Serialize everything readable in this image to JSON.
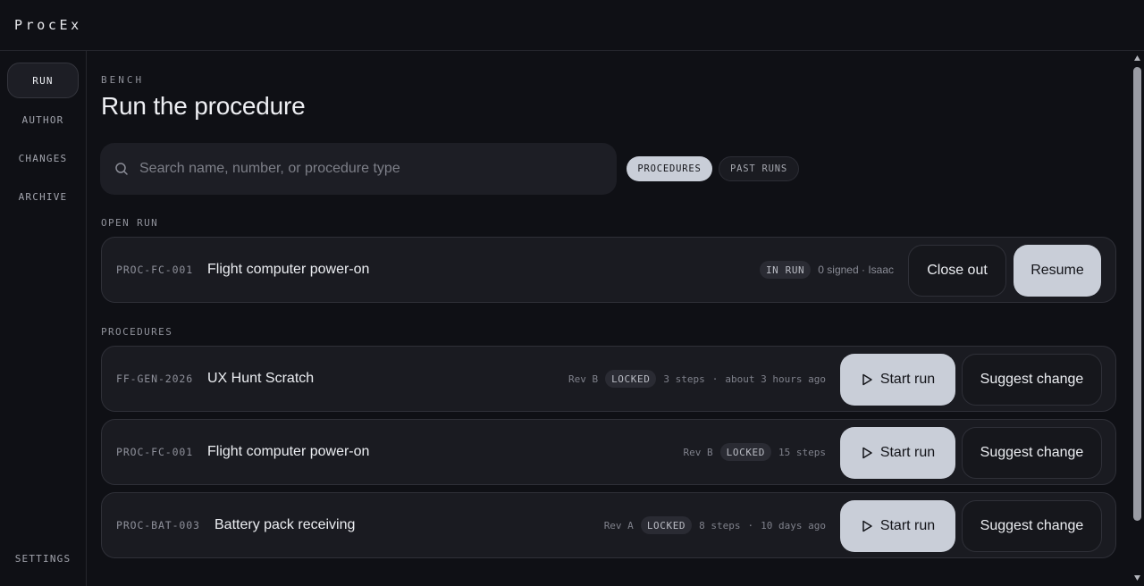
{
  "app": {
    "brand": "ProcEx"
  },
  "nav": {
    "items": [
      {
        "label": "RUN",
        "active": true
      },
      {
        "label": "AUTHOR",
        "active": false
      },
      {
        "label": "CHANGES",
        "active": false
      },
      {
        "label": "ARCHIVE",
        "active": false
      }
    ],
    "settings": "SETTINGS"
  },
  "header": {
    "eyebrow": "BENCH",
    "title": "Run the procedure"
  },
  "search": {
    "placeholder": "Search name, number, or procedure type",
    "value": ""
  },
  "filters": [
    {
      "label": "PROCEDURES",
      "active": true
    },
    {
      "label": "PAST RUNS",
      "active": false
    }
  ],
  "open_run": {
    "section_label": "OPEN RUN",
    "code": "PROC-FC-001",
    "name": "Flight computer power-on",
    "status": "IN RUN",
    "signed": "0 signed · Isaac",
    "close_label": "Close out",
    "resume_label": "Resume"
  },
  "procedures": {
    "section_label": "PROCEDURES",
    "start_label": "Start run",
    "suggest_label": "Suggest change",
    "items": [
      {
        "code": "FF-GEN-2026",
        "name": "UX Hunt Scratch",
        "rev": "Rev B",
        "lock": "LOCKED",
        "steps": "3 steps",
        "sep": "·",
        "age": "about 3 hours ago"
      },
      {
        "code": "PROC-FC-001",
        "name": "Flight computer power-on",
        "rev": "Rev B",
        "lock": "LOCKED",
        "steps": "15 steps",
        "sep": "",
        "age": ""
      },
      {
        "code": "PROC-BAT-003",
        "name": "Battery pack receiving",
        "rev": "Rev A",
        "lock": "LOCKED",
        "steps": "8 steps",
        "sep": "·",
        "age": "10 days ago"
      }
    ]
  },
  "colors": {
    "background": "#0f1015",
    "card": "#1a1b21",
    "accent_button": "#c9ced8"
  }
}
